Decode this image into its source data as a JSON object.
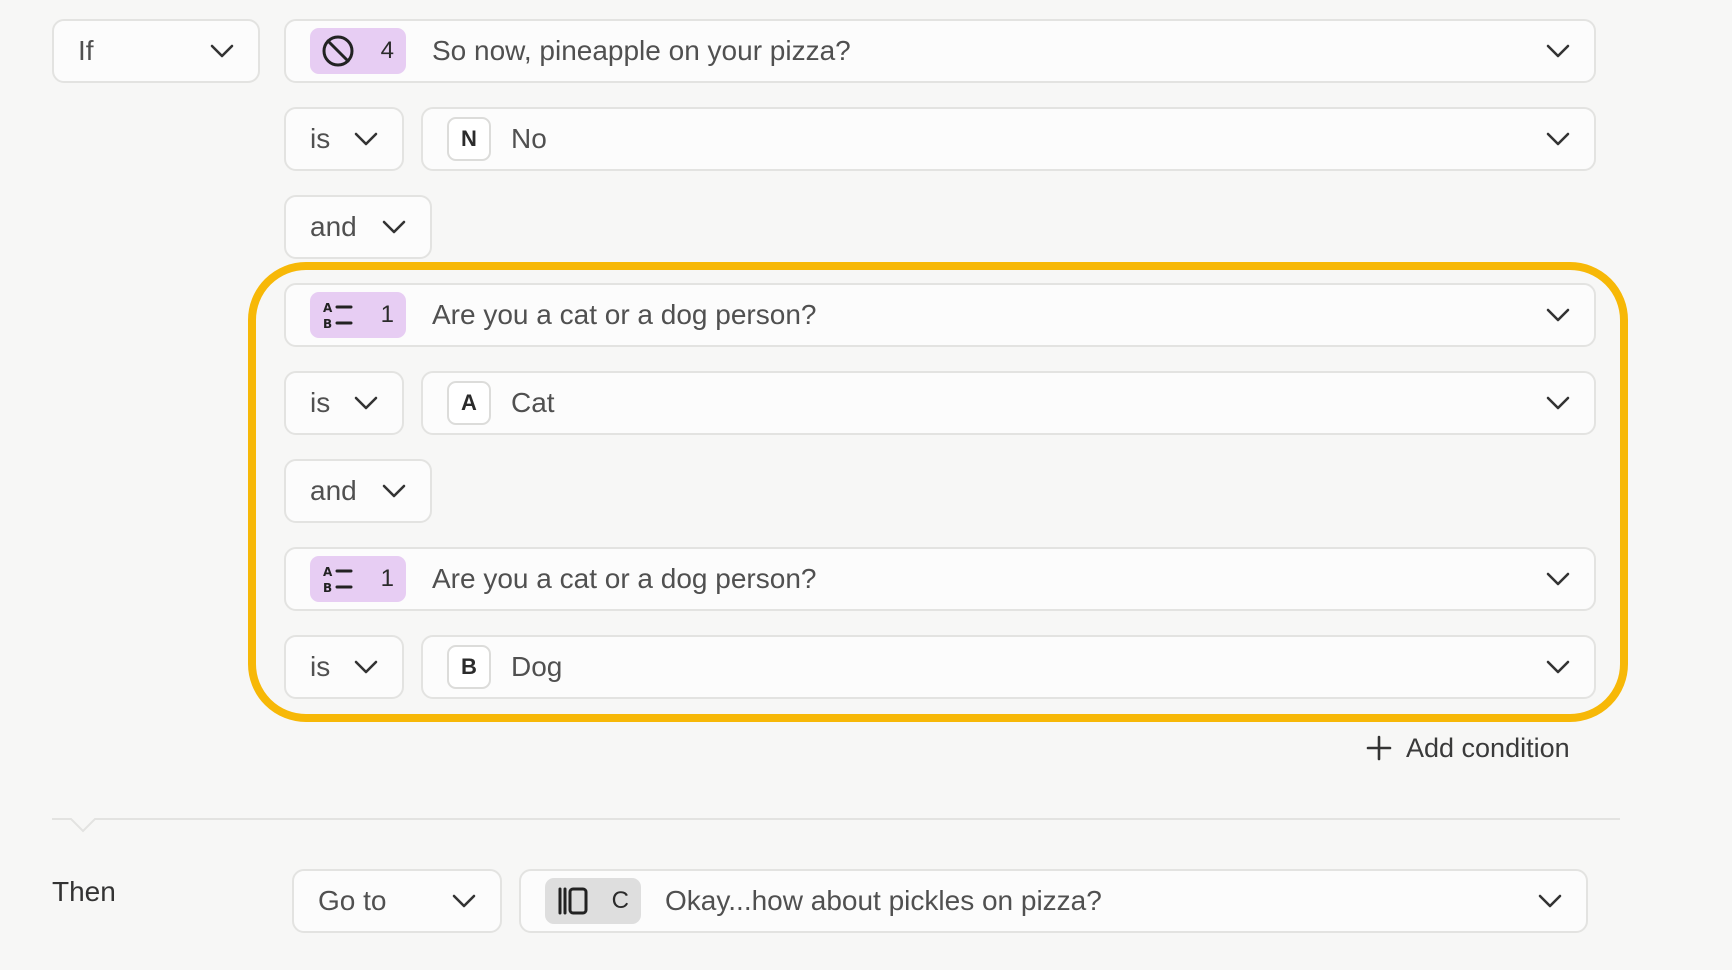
{
  "logic": {
    "if_label": "If",
    "question1": {
      "number": "4",
      "icon": "circle-slash-icon",
      "text": "So now, pineapple on your pizza?"
    },
    "op1": "is",
    "answer1": {
      "key": "N",
      "text": "No"
    },
    "joiner1": "and",
    "question2": {
      "number": "1",
      "icon": "multiple-choice-icon",
      "text": "Are you a cat or a dog person?"
    },
    "op2": "is",
    "answer2": {
      "key": "A",
      "text": "Cat"
    },
    "joiner2": "and",
    "question3": {
      "number": "1",
      "icon": "multiple-choice-icon",
      "text": "Are you a cat or a dog person?"
    },
    "op3": "is",
    "answer3": {
      "key": "B",
      "text": "Dog"
    },
    "add_condition": "Add condition"
  },
  "then": {
    "label": "Then",
    "action": "Go to",
    "target": {
      "key": "C",
      "icon": "picture-choice-icon",
      "text": "Okay...how about pickles on pizza?"
    }
  },
  "colors": {
    "highlight": "#f7b807",
    "question_badge": "#e7cdf3",
    "target_badge": "#dedede"
  }
}
